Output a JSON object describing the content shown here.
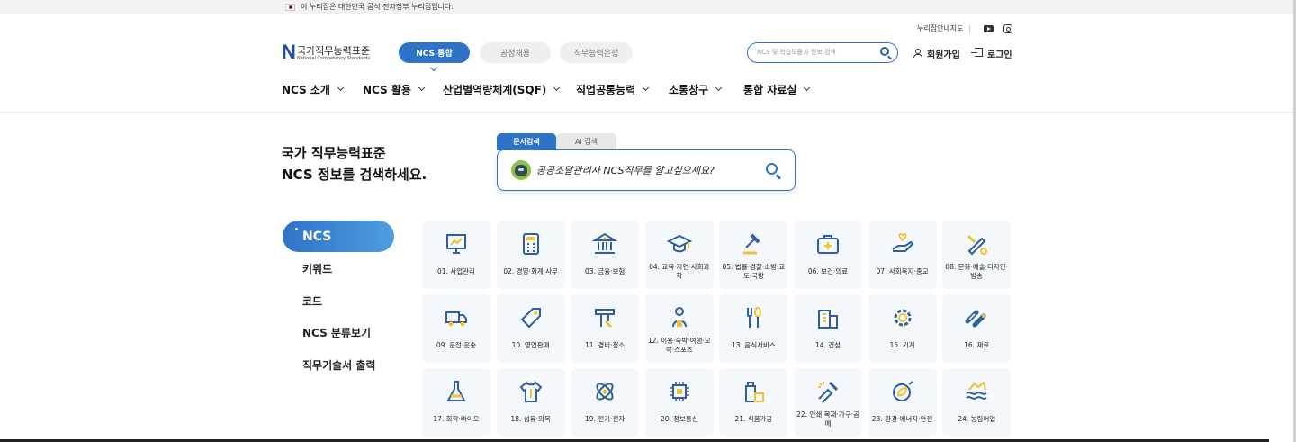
{
  "topbar": {
    "gov_notice": "이 누리집은 대한민국 공식 전자정부 누리집입니다."
  },
  "header": {
    "util_link": "누리집안내지도",
    "logo": {
      "kr": "국가직무능력표준",
      "en": "National Competency Standards"
    },
    "service_tabs": [
      {
        "label": "NCS 통합",
        "active": true
      },
      {
        "label": "공정채용",
        "active": false
      },
      {
        "label": "직무능력은행",
        "active": false
      }
    ],
    "search_placeholder": "NCS 및 학습모듈과 정보 검색",
    "signup": "회원가입",
    "login": "로그인",
    "gnb": [
      "NCS 소개",
      "NCS 활용",
      "산업별역량체계(SQF)",
      "직업공통능력",
      "소통창구",
      "통합 자료실"
    ]
  },
  "hero": {
    "title_line1": "국가 직무능력표준",
    "title_line2": "NCS 정보를 검색하세요.",
    "search_tabs": [
      "문서검색",
      "AI 검색"
    ],
    "search_prompt": "공공조달관리사 NCS직무를 알고싶으세요?"
  },
  "side_menu": [
    "NCS",
    "키워드",
    "코드",
    "NCS 분류보기",
    "직무기술서 출력"
  ],
  "categories": [
    {
      "label": "01. 사업관리",
      "icon": "presentation-board-icon"
    },
    {
      "label": "02. 경영·회계·사무",
      "icon": "calculator-icon"
    },
    {
      "label": "03. 금융·보험",
      "icon": "bank-icon"
    },
    {
      "label": "04. 교육·자연·사회과학",
      "icon": "graduation-cap-icon"
    },
    {
      "label": "05. 법률·경찰·소방·교도·국방",
      "icon": "gavel-icon"
    },
    {
      "label": "06. 보건·의료",
      "icon": "medical-kit-icon"
    },
    {
      "label": "07. 사회복지·종교",
      "icon": "hand-heart-icon"
    },
    {
      "label": "08. 문화·예술·디자인·방송",
      "icon": "design-tools-icon"
    },
    {
      "label": "09. 운전·운송",
      "icon": "truck-icon"
    },
    {
      "label": "10. 영업판매",
      "icon": "price-tag-icon"
    },
    {
      "label": "11. 경비·청소",
      "icon": "cleaning-icon"
    },
    {
      "label": "12. 이용·숙박·여행·오락·스포츠",
      "icon": "traveler-icon"
    },
    {
      "label": "13. 음식서비스",
      "icon": "fork-spoon-icon"
    },
    {
      "label": "14. 건설",
      "icon": "building-icon"
    },
    {
      "label": "15. 기계",
      "icon": "gear-icon"
    },
    {
      "label": "16. 재료",
      "icon": "pipes-icon"
    },
    {
      "label": "17. 화학·바이오",
      "icon": "flask-icon"
    },
    {
      "label": "18. 섬유·의복",
      "icon": "shirt-icon"
    },
    {
      "label": "19. 전기·전자",
      "icon": "atom-icon"
    },
    {
      "label": "20. 정보통신",
      "icon": "chip-icon"
    },
    {
      "label": "21. 식품가공",
      "icon": "food-package-icon"
    },
    {
      "label": "22. 인쇄·목재·가구·공예",
      "icon": "print-craft-icon"
    },
    {
      "label": "23. 환경·에너지·안전",
      "icon": "eco-energy-icon"
    },
    {
      "label": "24. 농림어업",
      "icon": "farming-icon"
    }
  ],
  "colors": {
    "accent": "#2f73c7",
    "icon_blue": "#2f5f9e",
    "icon_yellow": "#f2c230",
    "card_bg": "#f4f7fb"
  }
}
